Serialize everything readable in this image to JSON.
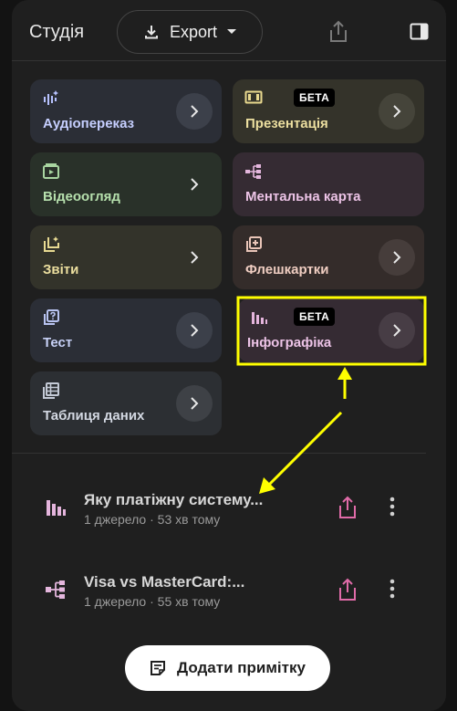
{
  "header": {
    "title": "Студія",
    "export_label": "Export"
  },
  "cards": [
    {
      "id": "audio",
      "label": "Аудіопереказ",
      "icon": "waveform-sparkle-icon"
    },
    {
      "id": "presentation",
      "label": "Презентація",
      "badge": "БЕТА",
      "icon": "slides-icon"
    },
    {
      "id": "video",
      "label": "Відеоогляд",
      "icon": "video-icon"
    },
    {
      "id": "mindmap",
      "label": "Ментальна карта",
      "icon": "mindmap-icon"
    },
    {
      "id": "reports",
      "label": "Звіти",
      "icon": "report-sparkle-icon"
    },
    {
      "id": "flashcards",
      "label": "Флешкартки",
      "icon": "flashcards-icon"
    },
    {
      "id": "test",
      "label": "Тест",
      "icon": "quiz-icon"
    },
    {
      "id": "infographic",
      "label": "Інфографіка",
      "badge": "БЕТА",
      "icon": "bar-chart-icon"
    },
    {
      "id": "datatable",
      "label": "Таблиця даних",
      "icon": "table-icon"
    }
  ],
  "notes": [
    {
      "title": "Яку платіжну систему...",
      "meta": "1 джерело · 53 хв тому",
      "icon": "bar-chart-icon"
    },
    {
      "title": "Visa vs MasterCard:...",
      "meta": "1 джерело · 55 хв тому",
      "icon": "mindmap-icon"
    }
  ],
  "add_note_label": "Додати примітку",
  "colors": {
    "annotation": "#ffff00",
    "note_accent": "#e06ba8"
  }
}
